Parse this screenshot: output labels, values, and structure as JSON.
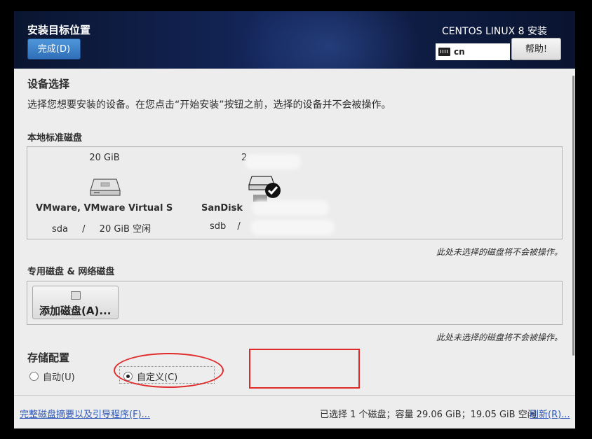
{
  "header": {
    "title": "安装目标位置",
    "done_label": "完成(D)",
    "product": "CENTOS LINUX 8 安装",
    "keyboard_layout": "cn",
    "help_label": "帮助!"
  },
  "device_selection": {
    "title": "设备选择",
    "description": "选择您想要安装的设备。在您点击“开始安装”按钮之前，选择的设备并不会被操作。"
  },
  "local_disks": {
    "title": "本地标准磁盘",
    "note": "此处未选择的磁盘将不会被操作。",
    "disks": [
      {
        "size": "20 GiB",
        "name": "VMware, VMware Virtual S",
        "device": "sda",
        "separator": "/",
        "free": "20 GiB 空闲",
        "selected": false
      },
      {
        "size": "2",
        "name": "SanDisk",
        "device": "sdb",
        "separator": "/",
        "free": "",
        "selected": true
      }
    ]
  },
  "specialized": {
    "title": "专用磁盘 & 网络磁盘",
    "add_disk_label": "添加磁盘(A)...",
    "note": "此处未选择的磁盘将不会被操作。"
  },
  "storage_config": {
    "title": "存储配置",
    "options": [
      {
        "label": "自动(U)",
        "selected": false
      },
      {
        "label": "自定义(C)",
        "selected": true
      }
    ]
  },
  "footer": {
    "summary_link": "完整磁盘摘要以及引导程序(F)...",
    "status": "已选择 1 个磁盘；容量 29.06 GiB；19.05 GiB 空闲",
    "refresh_link": "刷新(R)..."
  },
  "colors": {
    "accent": "#2f6fb9",
    "link": "#2b56b8",
    "annotation": "#e02a2a"
  }
}
